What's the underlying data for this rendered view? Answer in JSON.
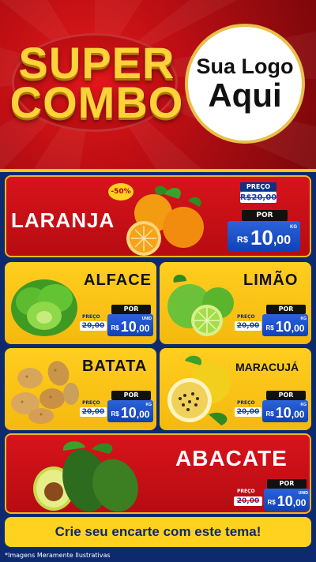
{
  "header": {
    "title_line1": "SUPER",
    "title_line2": "COMBO",
    "logo_line1": "Sua Logo",
    "logo_line2": "Aqui"
  },
  "colors": {
    "red": "#c10f14",
    "yellow": "#ffce1f",
    "blue": "#1142b7",
    "navy": "#0d2a6e"
  },
  "products": [
    {
      "name": "LARANJA",
      "badge": "-50%",
      "preco_label": "PREÇO",
      "old_price": "R$20,00",
      "por_label": "POR",
      "currency": "R$",
      "price_int": "10",
      "price_dec": ",00",
      "unit": "KG",
      "icon": "orange-icon"
    },
    {
      "name": "ALFACE",
      "preco_label": "PREÇO",
      "old_price": "20,00",
      "por_label": "POR",
      "currency": "R$",
      "price_int": "10",
      "price_dec": ",00",
      "unit": "UNID",
      "icon": "lettuce-icon"
    },
    {
      "name": "LIMÃO",
      "preco_label": "PREÇO",
      "old_price": "20,00",
      "por_label": "POR",
      "currency": "R$",
      "price_int": "10",
      "price_dec": ",00",
      "unit": "KG",
      "icon": "lime-icon"
    },
    {
      "name": "BATATA",
      "preco_label": "PREÇO",
      "old_price": "20,00",
      "por_label": "POR",
      "currency": "R$",
      "price_int": "10",
      "price_dec": ",00",
      "unit": "KG",
      "icon": "potato-icon"
    },
    {
      "name": "MARACUJÁ",
      "preco_label": "PREÇO",
      "old_price": "20,00",
      "por_label": "POR",
      "currency": "R$",
      "price_int": "10",
      "price_dec": ",00",
      "unit": "KG",
      "icon": "passion-fruit-icon"
    },
    {
      "name": "ABACATE",
      "preco_label": "PREÇO",
      "old_price": "20,00",
      "por_label": "POR",
      "currency": "R$",
      "price_int": "10",
      "price_dec": ",00",
      "unit": "UNID",
      "icon": "avocado-icon"
    }
  ],
  "cta": "Crie seu encarte com este tema!",
  "footnote": "*Imagens Meramente Ilustrativas"
}
